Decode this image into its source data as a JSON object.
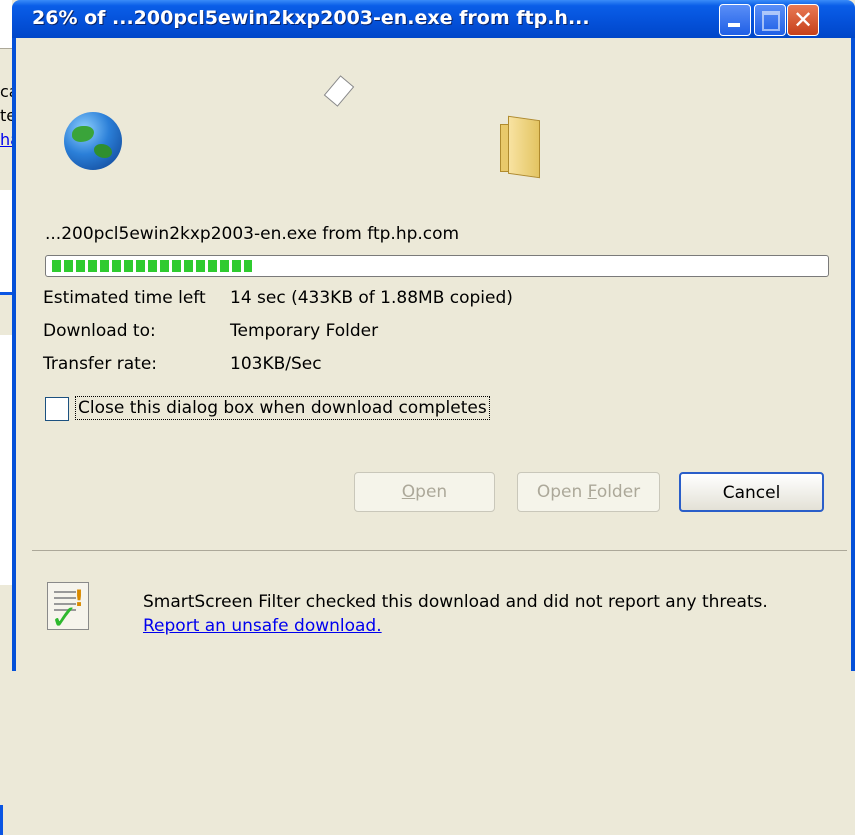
{
  "background": {
    "fragments": [
      "ca",
      "te",
      "ha"
    ]
  },
  "dialog": {
    "title": "26% of ...200pcl5ewin2kxp2003-en.exe from ftp.h...",
    "title_buttons": {
      "minimize": "minimize-icon",
      "maximize": "maximize-icon",
      "close": "close-icon"
    },
    "file_line": "...200pcl5ewin2kxp2003-en.exe from ftp.hp.com",
    "progress_percent": 26,
    "progress_color": "#2fcb2f",
    "info": [
      {
        "label": "Estimated time left",
        "value": "14 sec (433KB of 1.88MB copied)"
      },
      {
        "label": "Download to:",
        "value": "Temporary Folder"
      },
      {
        "label": "Transfer rate:",
        "value": "103KB/Sec"
      }
    ],
    "close_checkbox_label": "Close this dialog box when download completes",
    "close_checkbox_checked": false,
    "buttons": {
      "open_pre": "",
      "open_key": "O",
      "open_post": "pen",
      "open_folder_pre": "Open ",
      "open_folder_key": "F",
      "open_folder_post": "older",
      "cancel": "Cancel"
    },
    "smartscreen_text": "SmartScreen Filter checked this download and did not report any threats.",
    "smartscreen_link": "Report an unsafe download."
  },
  "colors": {
    "titlebar": "#0450d8",
    "link": "#0000ee",
    "disabled_text": "#aca899"
  }
}
